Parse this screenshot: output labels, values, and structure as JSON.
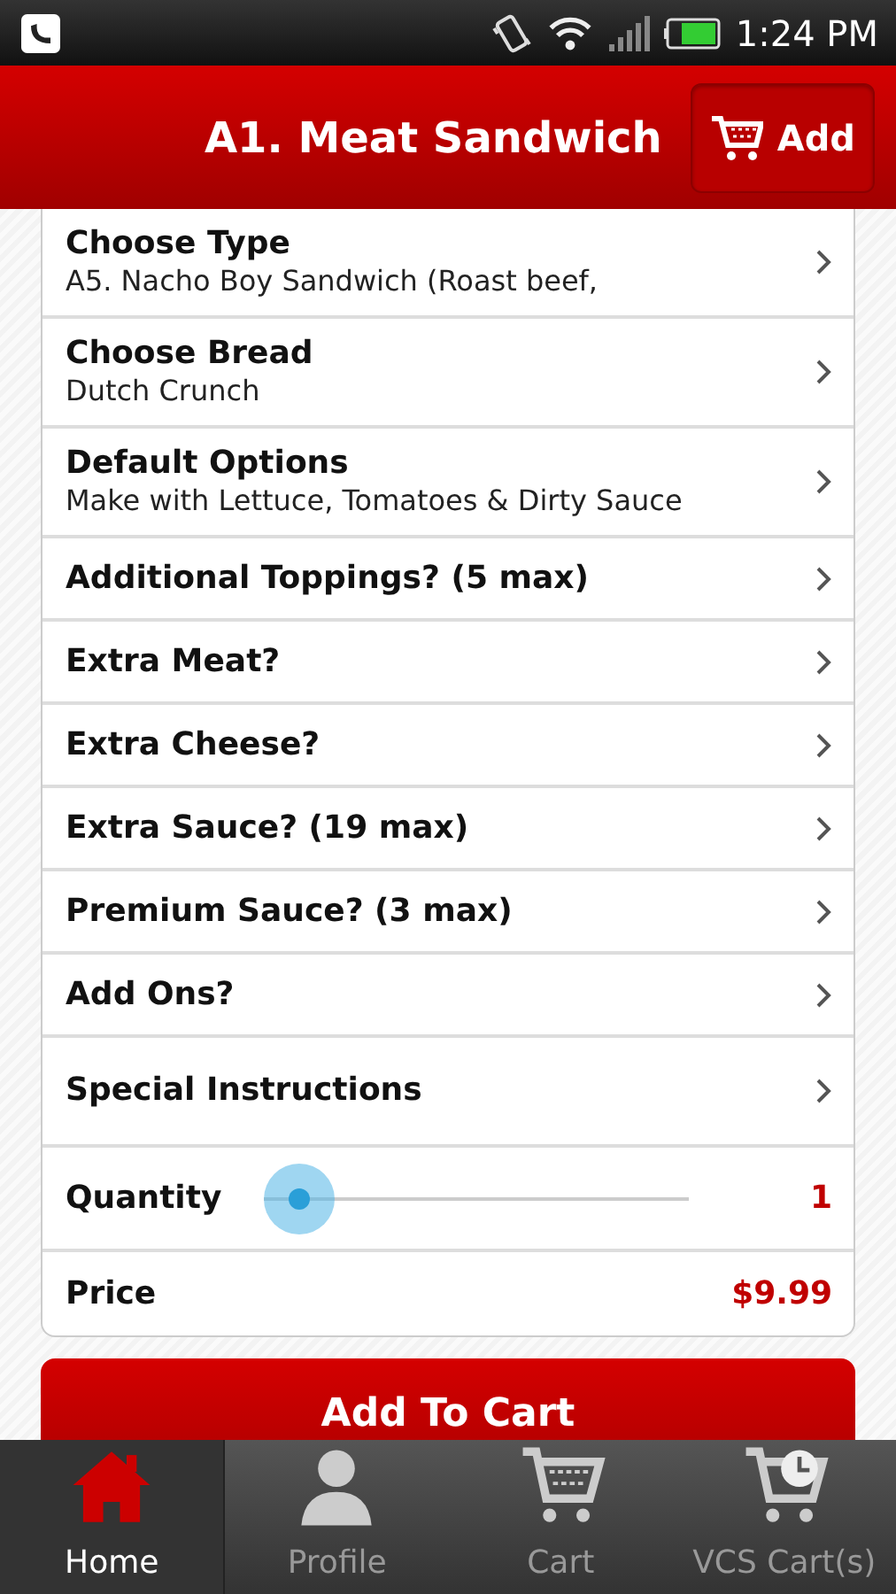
{
  "status_bar": {
    "time": "1:24 PM"
  },
  "header": {
    "title": "A1. Meat Sandwich",
    "add_button": "Add"
  },
  "options": [
    {
      "kind": "choice",
      "label": "Choose Type",
      "value": "A5. Nacho Boy Sandwich (Roast beef,"
    },
    {
      "kind": "choice",
      "label": "Choose Bread",
      "value": "Dutch Crunch"
    },
    {
      "kind": "choice",
      "label": "Default Options",
      "value": "Make with Lettuce, Tomatoes & Dirty Sauce"
    },
    {
      "kind": "link",
      "label": "Additional Toppings? (5 max)"
    },
    {
      "kind": "link",
      "label": "Extra Meat?"
    },
    {
      "kind": "link",
      "label": "Extra Cheese?"
    },
    {
      "kind": "link",
      "label": "Extra Sauce? (19 max)"
    },
    {
      "kind": "link",
      "label": "Premium Sauce? (3 max)"
    },
    {
      "kind": "link",
      "label": "Add Ons?"
    },
    {
      "kind": "tall_link",
      "label": "Special Instructions"
    },
    {
      "kind": "slider",
      "label": "Quantity",
      "level": 0,
      "reading": "1"
    },
    {
      "kind": "price",
      "label": "Price",
      "reading": "$9.99"
    }
  ],
  "add_to_cart": "Add To Cart",
  "tabs": [
    {
      "label": "Home",
      "kind": "home",
      "selected": true
    },
    {
      "label": "Profile",
      "kind": "person",
      "selected": false
    },
    {
      "label": "Cart",
      "kind": "cart",
      "selected": false
    },
    {
      "label": "VCS Cart(s)",
      "kind": "cart_clock",
      "selected": false
    }
  ]
}
